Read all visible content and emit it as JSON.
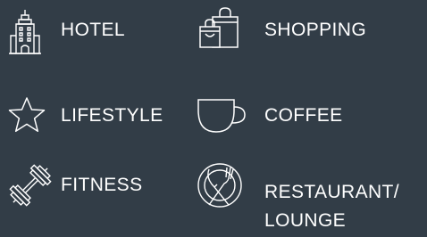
{
  "categories": {
    "hotel": {
      "label": "HOTEL",
      "icon": "hotel-building-icon"
    },
    "shopping": {
      "label": "SHOPPING",
      "icon": "shopping-bags-icon"
    },
    "lifestyle": {
      "label": "LIFESTYLE",
      "icon": "star-icon"
    },
    "coffee": {
      "label": "COFFEE",
      "icon": "coffee-cup-icon"
    },
    "fitness": {
      "label": "FITNESS",
      "icon": "dumbbell-icon"
    },
    "restaurant": {
      "label_line1": "RESTAURANT/",
      "label_line2": "LOUNGE",
      "icon": "plate-fork-knife-icon"
    }
  },
  "colors": {
    "background": "#323d47",
    "foreground": "#ffffff"
  }
}
